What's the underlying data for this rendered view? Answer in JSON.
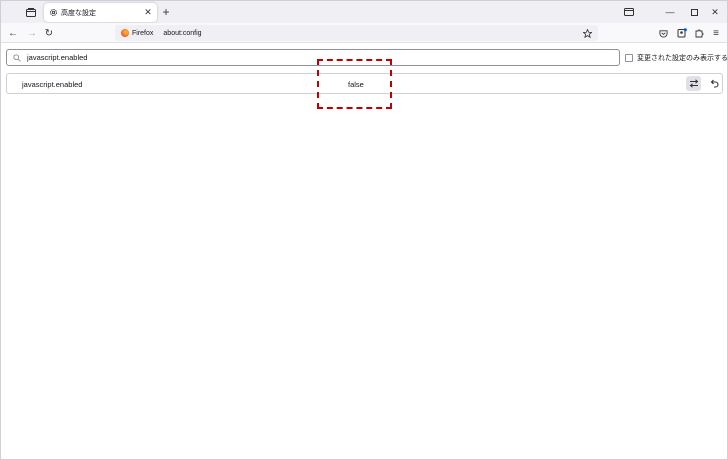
{
  "tab": {
    "title": "高度な設定",
    "icon": "gear-icon"
  },
  "navbar": {
    "identity_label": "Firefox",
    "url": "about:config"
  },
  "search": {
    "value": "javascript.enabled"
  },
  "filter": {
    "modified_only_label": "変更された設定のみ表示する",
    "checked": false
  },
  "preferences": [
    {
      "name": "javascript.enabled",
      "value": "false"
    }
  ],
  "colors": {
    "highlight": "#c00000",
    "accent": "#0060df"
  }
}
